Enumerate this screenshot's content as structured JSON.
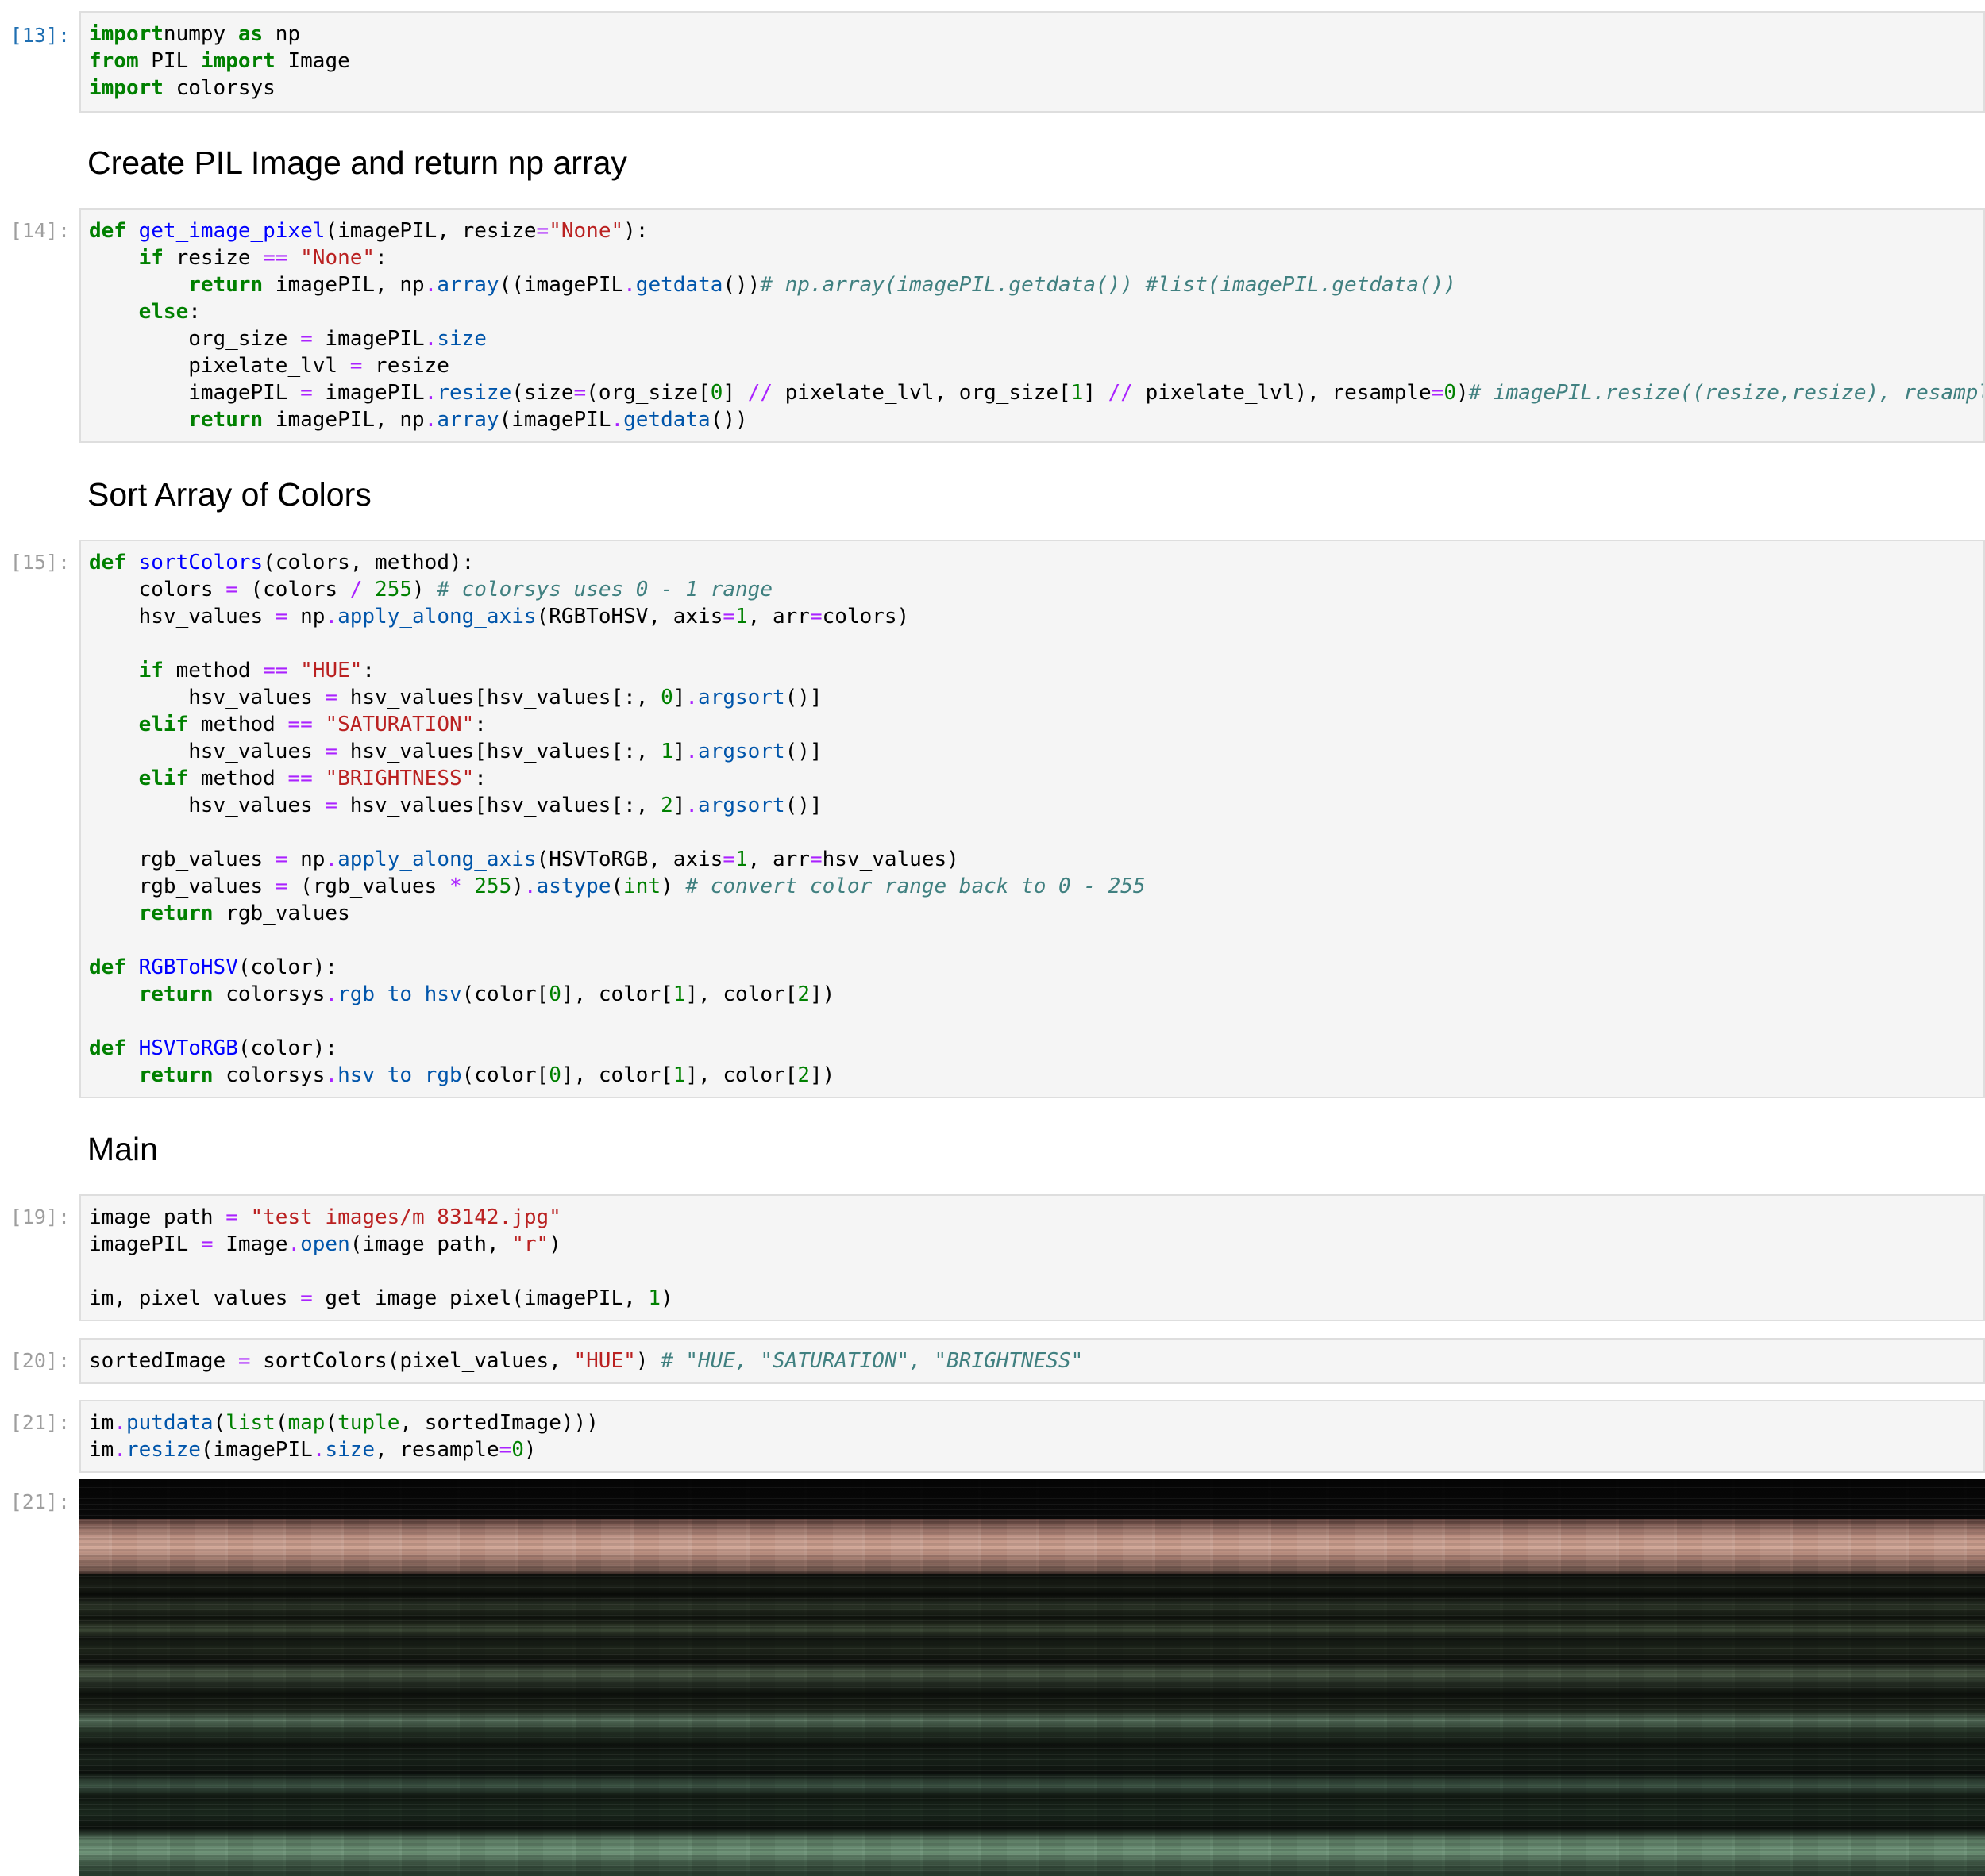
{
  "cells": [
    {
      "prompt": "[13]:",
      "lines": [
        [
          [
            "kw",
            "import"
          ],
          [
            "",
            "numpy "
          ],
          [
            "kw",
            "as"
          ],
          [
            "",
            " np"
          ]
        ],
        [
          [
            "kw",
            "from"
          ],
          [
            "",
            " PIL "
          ],
          [
            "kw",
            "import"
          ],
          [
            "",
            " Image"
          ]
        ],
        [
          [
            "kw",
            "import"
          ],
          [
            "",
            " colorsys"
          ]
        ]
      ]
    },
    {
      "prompt": "[14]:",
      "lines": [
        [
          [
            "kw",
            "def"
          ],
          [
            "",
            " "
          ],
          [
            "fn",
            "get_image_pixel"
          ],
          [
            "",
            "(imagePIL, resize"
          ],
          [
            "op",
            "="
          ],
          [
            "st",
            "\"None\""
          ],
          [
            "",
            "):"
          ]
        ],
        [
          [
            "",
            "    "
          ],
          [
            "kw",
            "if"
          ],
          [
            "",
            " resize "
          ],
          [
            "op",
            "=="
          ],
          [
            "",
            " "
          ],
          [
            "st",
            "\"None\""
          ],
          [
            "",
            ":"
          ]
        ],
        [
          [
            "",
            "        "
          ],
          [
            "kw",
            "return"
          ],
          [
            "",
            " imagePIL, np"
          ],
          [
            "op",
            "."
          ],
          [
            "at",
            "array"
          ],
          [
            "",
            "((imagePIL"
          ],
          [
            "op",
            "."
          ],
          [
            "at",
            "getdata"
          ],
          [
            "",
            "())"
          ],
          [
            "cm",
            "# np.array(imagePIL.getdata()) #list(imagePIL.getdata())"
          ]
        ],
        [
          [
            "",
            "    "
          ],
          [
            "kw",
            "else"
          ],
          [
            "",
            ":"
          ]
        ],
        [
          [
            "",
            "        org_size "
          ],
          [
            "op",
            "="
          ],
          [
            "",
            " imagePIL"
          ],
          [
            "op",
            "."
          ],
          [
            "at",
            "size"
          ]
        ],
        [
          [
            "",
            "        pixelate_lvl "
          ],
          [
            "op",
            "="
          ],
          [
            "",
            " resize"
          ]
        ],
        [
          [
            "",
            "        imagePIL "
          ],
          [
            "op",
            "="
          ],
          [
            "",
            " imagePIL"
          ],
          [
            "op",
            "."
          ],
          [
            "at",
            "resize"
          ],
          [
            "",
            "(size"
          ],
          [
            "op",
            "="
          ],
          [
            "",
            "(org_size["
          ],
          [
            "nu",
            "0"
          ],
          [
            "",
            "] "
          ],
          [
            "op",
            "//"
          ],
          [
            "",
            " pixelate_lvl, org_size["
          ],
          [
            "nu",
            "1"
          ],
          [
            "",
            "] "
          ],
          [
            "op",
            "//"
          ],
          [
            "",
            " pixelate_lvl), resample"
          ],
          [
            "op",
            "="
          ],
          [
            "nu",
            "0"
          ],
          [
            "",
            ")"
          ],
          [
            "cm",
            "# imagePIL.resize((resize,resize), resampl"
          ]
        ],
        [
          [
            "",
            "        "
          ],
          [
            "kw",
            "return"
          ],
          [
            "",
            " imagePIL, np"
          ],
          [
            "op",
            "."
          ],
          [
            "at",
            "array"
          ],
          [
            "",
            "(imagePIL"
          ],
          [
            "op",
            "."
          ],
          [
            "at",
            "getdata"
          ],
          [
            "",
            "())"
          ]
        ]
      ]
    },
    {
      "prompt": "[15]:",
      "lines": [
        [
          [
            "kw",
            "def"
          ],
          [
            "",
            " "
          ],
          [
            "fn",
            "sortColors"
          ],
          [
            "",
            "(colors, method):"
          ]
        ],
        [
          [
            "",
            "    colors "
          ],
          [
            "op",
            "="
          ],
          [
            "",
            " (colors "
          ],
          [
            "op",
            "/"
          ],
          [
            "",
            " "
          ],
          [
            "nu",
            "255"
          ],
          [
            "",
            ") "
          ],
          [
            "cm",
            "# colorsys uses 0 - 1 range"
          ]
        ],
        [
          [
            "",
            "    hsv_values "
          ],
          [
            "op",
            "="
          ],
          [
            "",
            " np"
          ],
          [
            "op",
            "."
          ],
          [
            "at",
            "apply_along_axis"
          ],
          [
            "",
            "(RGBToHSV, axis"
          ],
          [
            "op",
            "="
          ],
          [
            "nu",
            "1"
          ],
          [
            "",
            ", arr"
          ],
          [
            "op",
            "="
          ],
          [
            "",
            "colors)"
          ]
        ],
        [
          [
            "",
            ""
          ]
        ],
        [
          [
            "",
            "    "
          ],
          [
            "kw",
            "if"
          ],
          [
            "",
            " method "
          ],
          [
            "op",
            "=="
          ],
          [
            "",
            " "
          ],
          [
            "st",
            "\"HUE\""
          ],
          [
            "",
            ":"
          ]
        ],
        [
          [
            "",
            "        hsv_values "
          ],
          [
            "op",
            "="
          ],
          [
            "",
            " hsv_values[hsv_values[:, "
          ],
          [
            "nu",
            "0"
          ],
          [
            "",
            "]"
          ],
          [
            "op",
            "."
          ],
          [
            "at",
            "argsort"
          ],
          [
            "",
            "()]"
          ]
        ],
        [
          [
            "",
            "    "
          ],
          [
            "kw",
            "elif"
          ],
          [
            "",
            " method "
          ],
          [
            "op",
            "=="
          ],
          [
            "",
            " "
          ],
          [
            "st",
            "\"SATURATION\""
          ],
          [
            "",
            ":"
          ]
        ],
        [
          [
            "",
            "        hsv_values "
          ],
          [
            "op",
            "="
          ],
          [
            "",
            " hsv_values[hsv_values[:, "
          ],
          [
            "nu",
            "1"
          ],
          [
            "",
            "]"
          ],
          [
            "op",
            "."
          ],
          [
            "at",
            "argsort"
          ],
          [
            "",
            "()]"
          ]
        ],
        [
          [
            "",
            "    "
          ],
          [
            "kw",
            "elif"
          ],
          [
            "",
            " method "
          ],
          [
            "op",
            "=="
          ],
          [
            "",
            " "
          ],
          [
            "st",
            "\"BRIGHTNESS\""
          ],
          [
            "",
            ":"
          ]
        ],
        [
          [
            "",
            "        hsv_values "
          ],
          [
            "op",
            "="
          ],
          [
            "",
            " hsv_values[hsv_values[:, "
          ],
          [
            "nu",
            "2"
          ],
          [
            "",
            "]"
          ],
          [
            "op",
            "."
          ],
          [
            "at",
            "argsort"
          ],
          [
            "",
            "()]"
          ]
        ],
        [
          [
            "",
            ""
          ]
        ],
        [
          [
            "",
            "    rgb_values "
          ],
          [
            "op",
            "="
          ],
          [
            "",
            " np"
          ],
          [
            "op",
            "."
          ],
          [
            "at",
            "apply_along_axis"
          ],
          [
            "",
            "(HSVToRGB, axis"
          ],
          [
            "op",
            "="
          ],
          [
            "nu",
            "1"
          ],
          [
            "",
            ", arr"
          ],
          [
            "op",
            "="
          ],
          [
            "",
            "hsv_values)"
          ]
        ],
        [
          [
            "",
            "    rgb_values "
          ],
          [
            "op",
            "="
          ],
          [
            "",
            " (rgb_values "
          ],
          [
            "op",
            "*"
          ],
          [
            "",
            " "
          ],
          [
            "nu",
            "255"
          ],
          [
            "",
            ")"
          ],
          [
            "op",
            "."
          ],
          [
            "at",
            "astype"
          ],
          [
            "",
            "("
          ],
          [
            "bi",
            "int"
          ],
          [
            "",
            ") "
          ],
          [
            "cm",
            "# convert color range back to 0 - 255"
          ]
        ],
        [
          [
            "",
            "    "
          ],
          [
            "kw",
            "return"
          ],
          [
            "",
            " rgb_values"
          ]
        ],
        [
          [
            "",
            ""
          ]
        ],
        [
          [
            "kw",
            "def"
          ],
          [
            "",
            " "
          ],
          [
            "fn",
            "RGBToHSV"
          ],
          [
            "",
            "(color):"
          ]
        ],
        [
          [
            "",
            "    "
          ],
          [
            "kw",
            "return"
          ],
          [
            "",
            " colorsys"
          ],
          [
            "op",
            "."
          ],
          [
            "at",
            "rgb_to_hsv"
          ],
          [
            "",
            "(color["
          ],
          [
            "nu",
            "0"
          ],
          [
            "",
            "], color["
          ],
          [
            "nu",
            "1"
          ],
          [
            "",
            "], color["
          ],
          [
            "nu",
            "2"
          ],
          [
            "",
            "])"
          ]
        ],
        [
          [
            "",
            ""
          ]
        ],
        [
          [
            "kw",
            "def"
          ],
          [
            "",
            " "
          ],
          [
            "fn",
            "HSVToRGB"
          ],
          [
            "",
            "(color):"
          ]
        ],
        [
          [
            "",
            "    "
          ],
          [
            "kw",
            "return"
          ],
          [
            "",
            " colorsys"
          ],
          [
            "op",
            "."
          ],
          [
            "at",
            "hsv_to_rgb"
          ],
          [
            "",
            "(color["
          ],
          [
            "nu",
            "0"
          ],
          [
            "",
            "], color["
          ],
          [
            "nu",
            "1"
          ],
          [
            "",
            "], color["
          ],
          [
            "nu",
            "2"
          ],
          [
            "",
            "])"
          ]
        ]
      ]
    },
    {
      "prompt": "[19]:",
      "lines": [
        [
          [
            "",
            "image_path "
          ],
          [
            "op",
            "="
          ],
          [
            "",
            " "
          ],
          [
            "st",
            "\"test_images/m_83142.jpg\""
          ]
        ],
        [
          [
            "",
            "imagePIL "
          ],
          [
            "op",
            "="
          ],
          [
            "",
            " Image"
          ],
          [
            "op",
            "."
          ],
          [
            "at",
            "open"
          ],
          [
            "",
            "(image_path, "
          ],
          [
            "st",
            "\"r\""
          ],
          [
            "",
            ")"
          ]
        ],
        [
          [
            "",
            ""
          ]
        ],
        [
          [
            "",
            "im, pixel_values "
          ],
          [
            "op",
            "="
          ],
          [
            "",
            " get_image_pixel(imagePIL, "
          ],
          [
            "nu",
            "1"
          ],
          [
            "",
            ")"
          ]
        ]
      ]
    },
    {
      "prompt": "[20]:",
      "lines": [
        [
          [
            "",
            "sortedImage "
          ],
          [
            "op",
            "="
          ],
          [
            "",
            " sortColors(pixel_values, "
          ],
          [
            "st",
            "\"HUE\""
          ],
          [
            "",
            ") "
          ],
          [
            "cm",
            "# \"HUE, \"SATURATION\", \"BRIGHTNESS\""
          ]
        ]
      ]
    },
    {
      "prompt": "[21]:",
      "lines": [
        [
          [
            "",
            "im"
          ],
          [
            "op",
            "."
          ],
          [
            "at",
            "putdata"
          ],
          [
            "",
            "("
          ],
          [
            "bi",
            "list"
          ],
          [
            "",
            "("
          ],
          [
            "bi",
            "map"
          ],
          [
            "",
            "("
          ],
          [
            "bi",
            "tuple"
          ],
          [
            "",
            ", sortedImage)))"
          ]
        ],
        [
          [
            "",
            "im"
          ],
          [
            "op",
            "."
          ],
          [
            "at",
            "resize"
          ],
          [
            "",
            "(imagePIL"
          ],
          [
            "op",
            "."
          ],
          [
            "at",
            "size"
          ],
          [
            "",
            ", resample"
          ],
          [
            "op",
            "="
          ],
          [
            "nu",
            "0"
          ],
          [
            "",
            ")"
          ]
        ]
      ]
    }
  ],
  "headings": [
    "Create PIL Image and return np array",
    "Sort Array of Colors",
    "Main"
  ],
  "output_prompt": "[21]:"
}
